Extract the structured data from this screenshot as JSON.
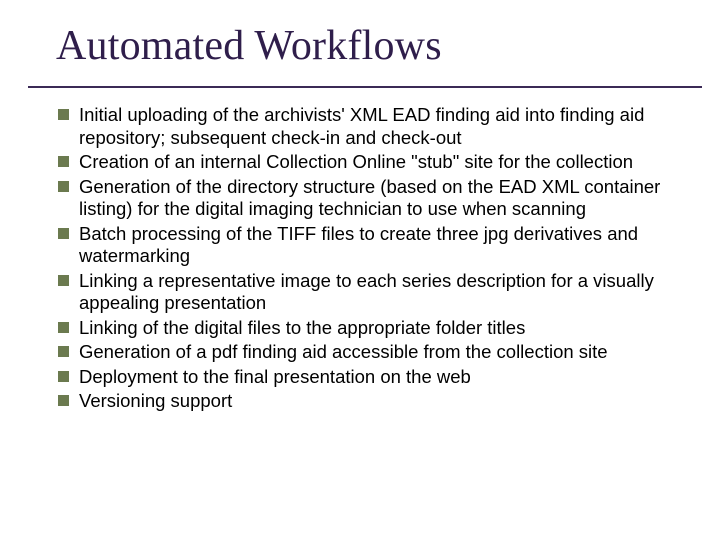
{
  "title": "Automated Workflows",
  "bullets": [
    "Initial uploading of the archivists' XML EAD finding aid into finding aid repository; subsequent check-in and check-out",
    "Creation of an internal Collection Online \"stub\" site for the collection",
    "Generation of the directory structure (based on the EAD XML container listing) for the digital imaging technician to use when scanning",
    "Batch processing of the TIFF files to create three jpg derivatives and watermarking",
    "Linking a representative image to each series description for a visually appealing presentation",
    "Linking of the digital files to the appropriate folder titles",
    "Generation of a pdf finding aid accessible from the collection site",
    "Deployment to the final presentation on the web",
    "Versioning support"
  ]
}
